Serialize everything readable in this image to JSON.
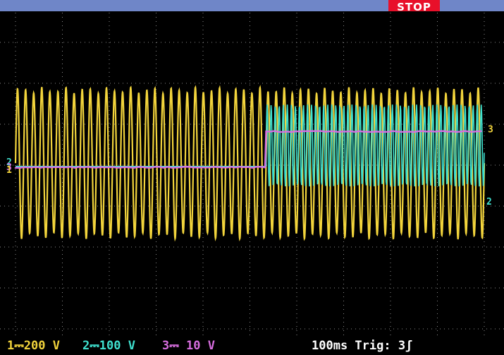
{
  "title_bar": {
    "status": "STOP",
    "status_color": "#e8102a",
    "bar_color": "#6f86c8"
  },
  "status_bar": {
    "ch1": "1⎓200 V",
    "ch2": "2⎓100 V",
    "ch3": "3⎓ 10 V",
    "timebase_trigger": "100ms Trig: 3ʃ"
  },
  "markers": {
    "ch1_left": "1",
    "ch2_left": "2",
    "ch3_left": "3",
    "ch2_right": "2",
    "ch3_right": "3"
  },
  "colors": {
    "ch1": "#f2d43c",
    "ch2": "#3fe0cf",
    "ch3": "#d86ee0",
    "grid": "#8a8a8a",
    "background": "#000000"
  },
  "chart_data": {
    "type": "line",
    "x_divisions": 10,
    "y_divisions": 8,
    "step_at_fraction": 0.5,
    "series": [
      {
        "name": "1",
        "waveform": "sine",
        "cycles": 58,
        "amplitude_div": 1.85,
        "offset_div": 0.05
      },
      {
        "name": "2",
        "waveform": "flat-then-burst",
        "before_offset_div": 0.0,
        "after_amplitude_div": 1.0,
        "after_offset_div": 0.55
      },
      {
        "name": "3",
        "waveform": "step",
        "before_offset_div": 0.05,
        "after_offset_div": 1.65
      }
    ]
  }
}
